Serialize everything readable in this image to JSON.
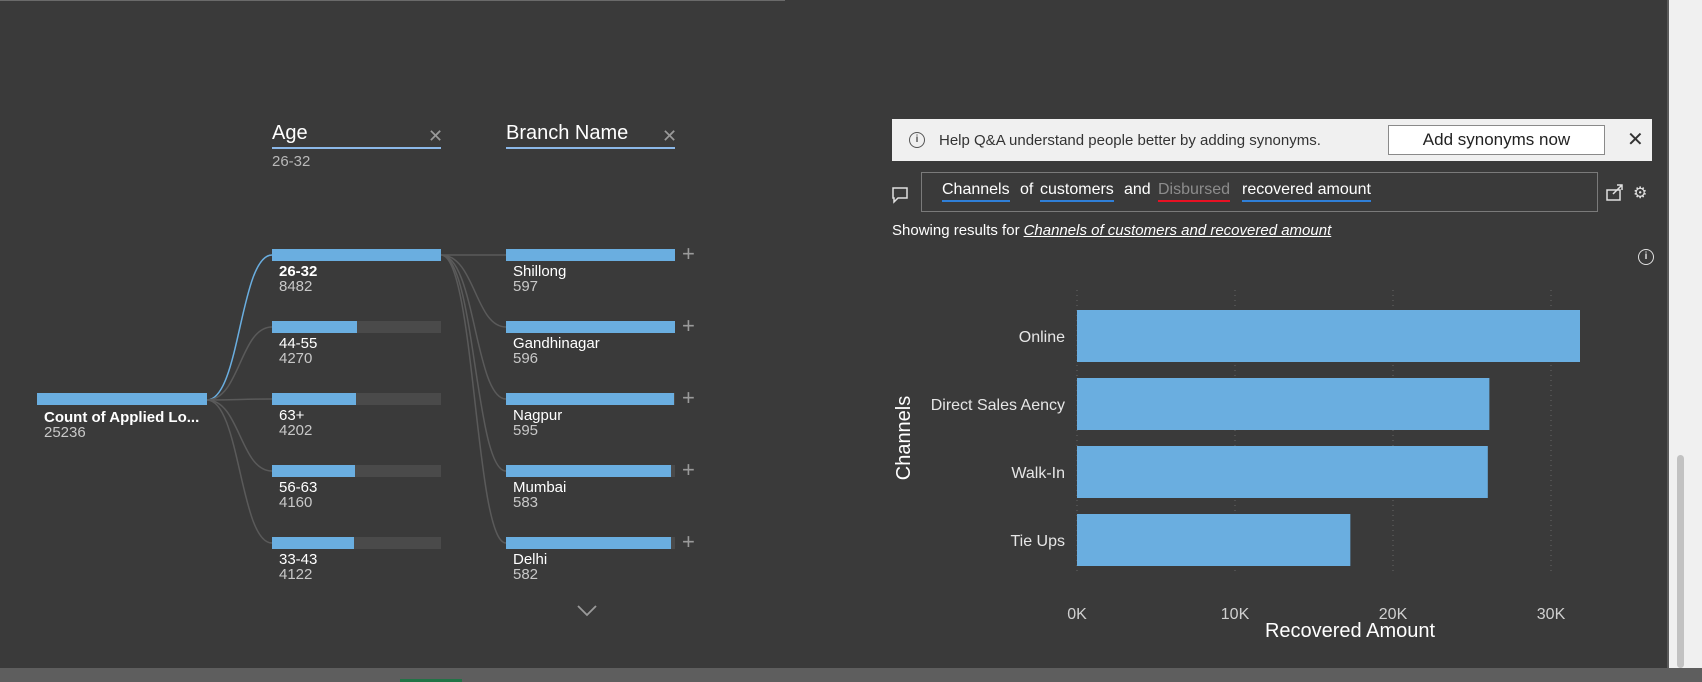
{
  "decomp": {
    "root": {
      "label": "Count of Applied Lo...",
      "value": "25236"
    },
    "age_column": {
      "title": "Age",
      "selected": "26-32"
    },
    "branch_column": {
      "title": "Branch Name",
      "selected": ""
    },
    "age_nodes": [
      {
        "label": "26-32",
        "value": "8482",
        "fill": 1.0
      },
      {
        "label": "44-55",
        "value": "4270",
        "fill": 0.503
      },
      {
        "label": "63+",
        "value": "4202",
        "fill": 0.495
      },
      {
        "label": "56-63",
        "value": "4160",
        "fill": 0.49
      },
      {
        "label": "33-43",
        "value": "4122",
        "fill": 0.486
      }
    ],
    "branch_nodes": [
      {
        "label": "Shillong",
        "value": "597",
        "fill": 1.0
      },
      {
        "label": "Gandhinagar",
        "value": "596",
        "fill": 0.998
      },
      {
        "label": "Nagpur",
        "value": "595",
        "fill": 0.997
      },
      {
        "label": "Mumbai",
        "value": "583",
        "fill": 0.977
      },
      {
        "label": "Delhi",
        "value": "582",
        "fill": 0.975
      }
    ]
  },
  "qa": {
    "banner_message": "Help Q&A understand people better by adding synonyms.",
    "banner_button": "Add synonyms now",
    "query_words": [
      "Channels",
      "of",
      "customers",
      "and",
      "Disbursed",
      "recovered amount"
    ],
    "showing_prefix": "Showing results for",
    "showing_link": "Channels of customers and recovered amount"
  },
  "chart_data": {
    "type": "bar",
    "orientation": "horizontal",
    "categories": [
      "Online",
      "Direct Sales Aency",
      "Walk-In",
      "Tie Ups"
    ],
    "values": [
      34800,
      26100,
      26000,
      17300
    ],
    "xlabel": "Recovered Amount",
    "ylabel": "Channels",
    "xticks": [
      "0K",
      "10K",
      "20K",
      "30K"
    ],
    "xlim": [
      0,
      35000
    ],
    "grid": true,
    "bar_color": "#6aaee0"
  },
  "colors": {
    "background": "#3a3a3a",
    "bar": "#6aaee0",
    "underline_blue": "#2f7fd8",
    "underline_red": "#e81123"
  }
}
